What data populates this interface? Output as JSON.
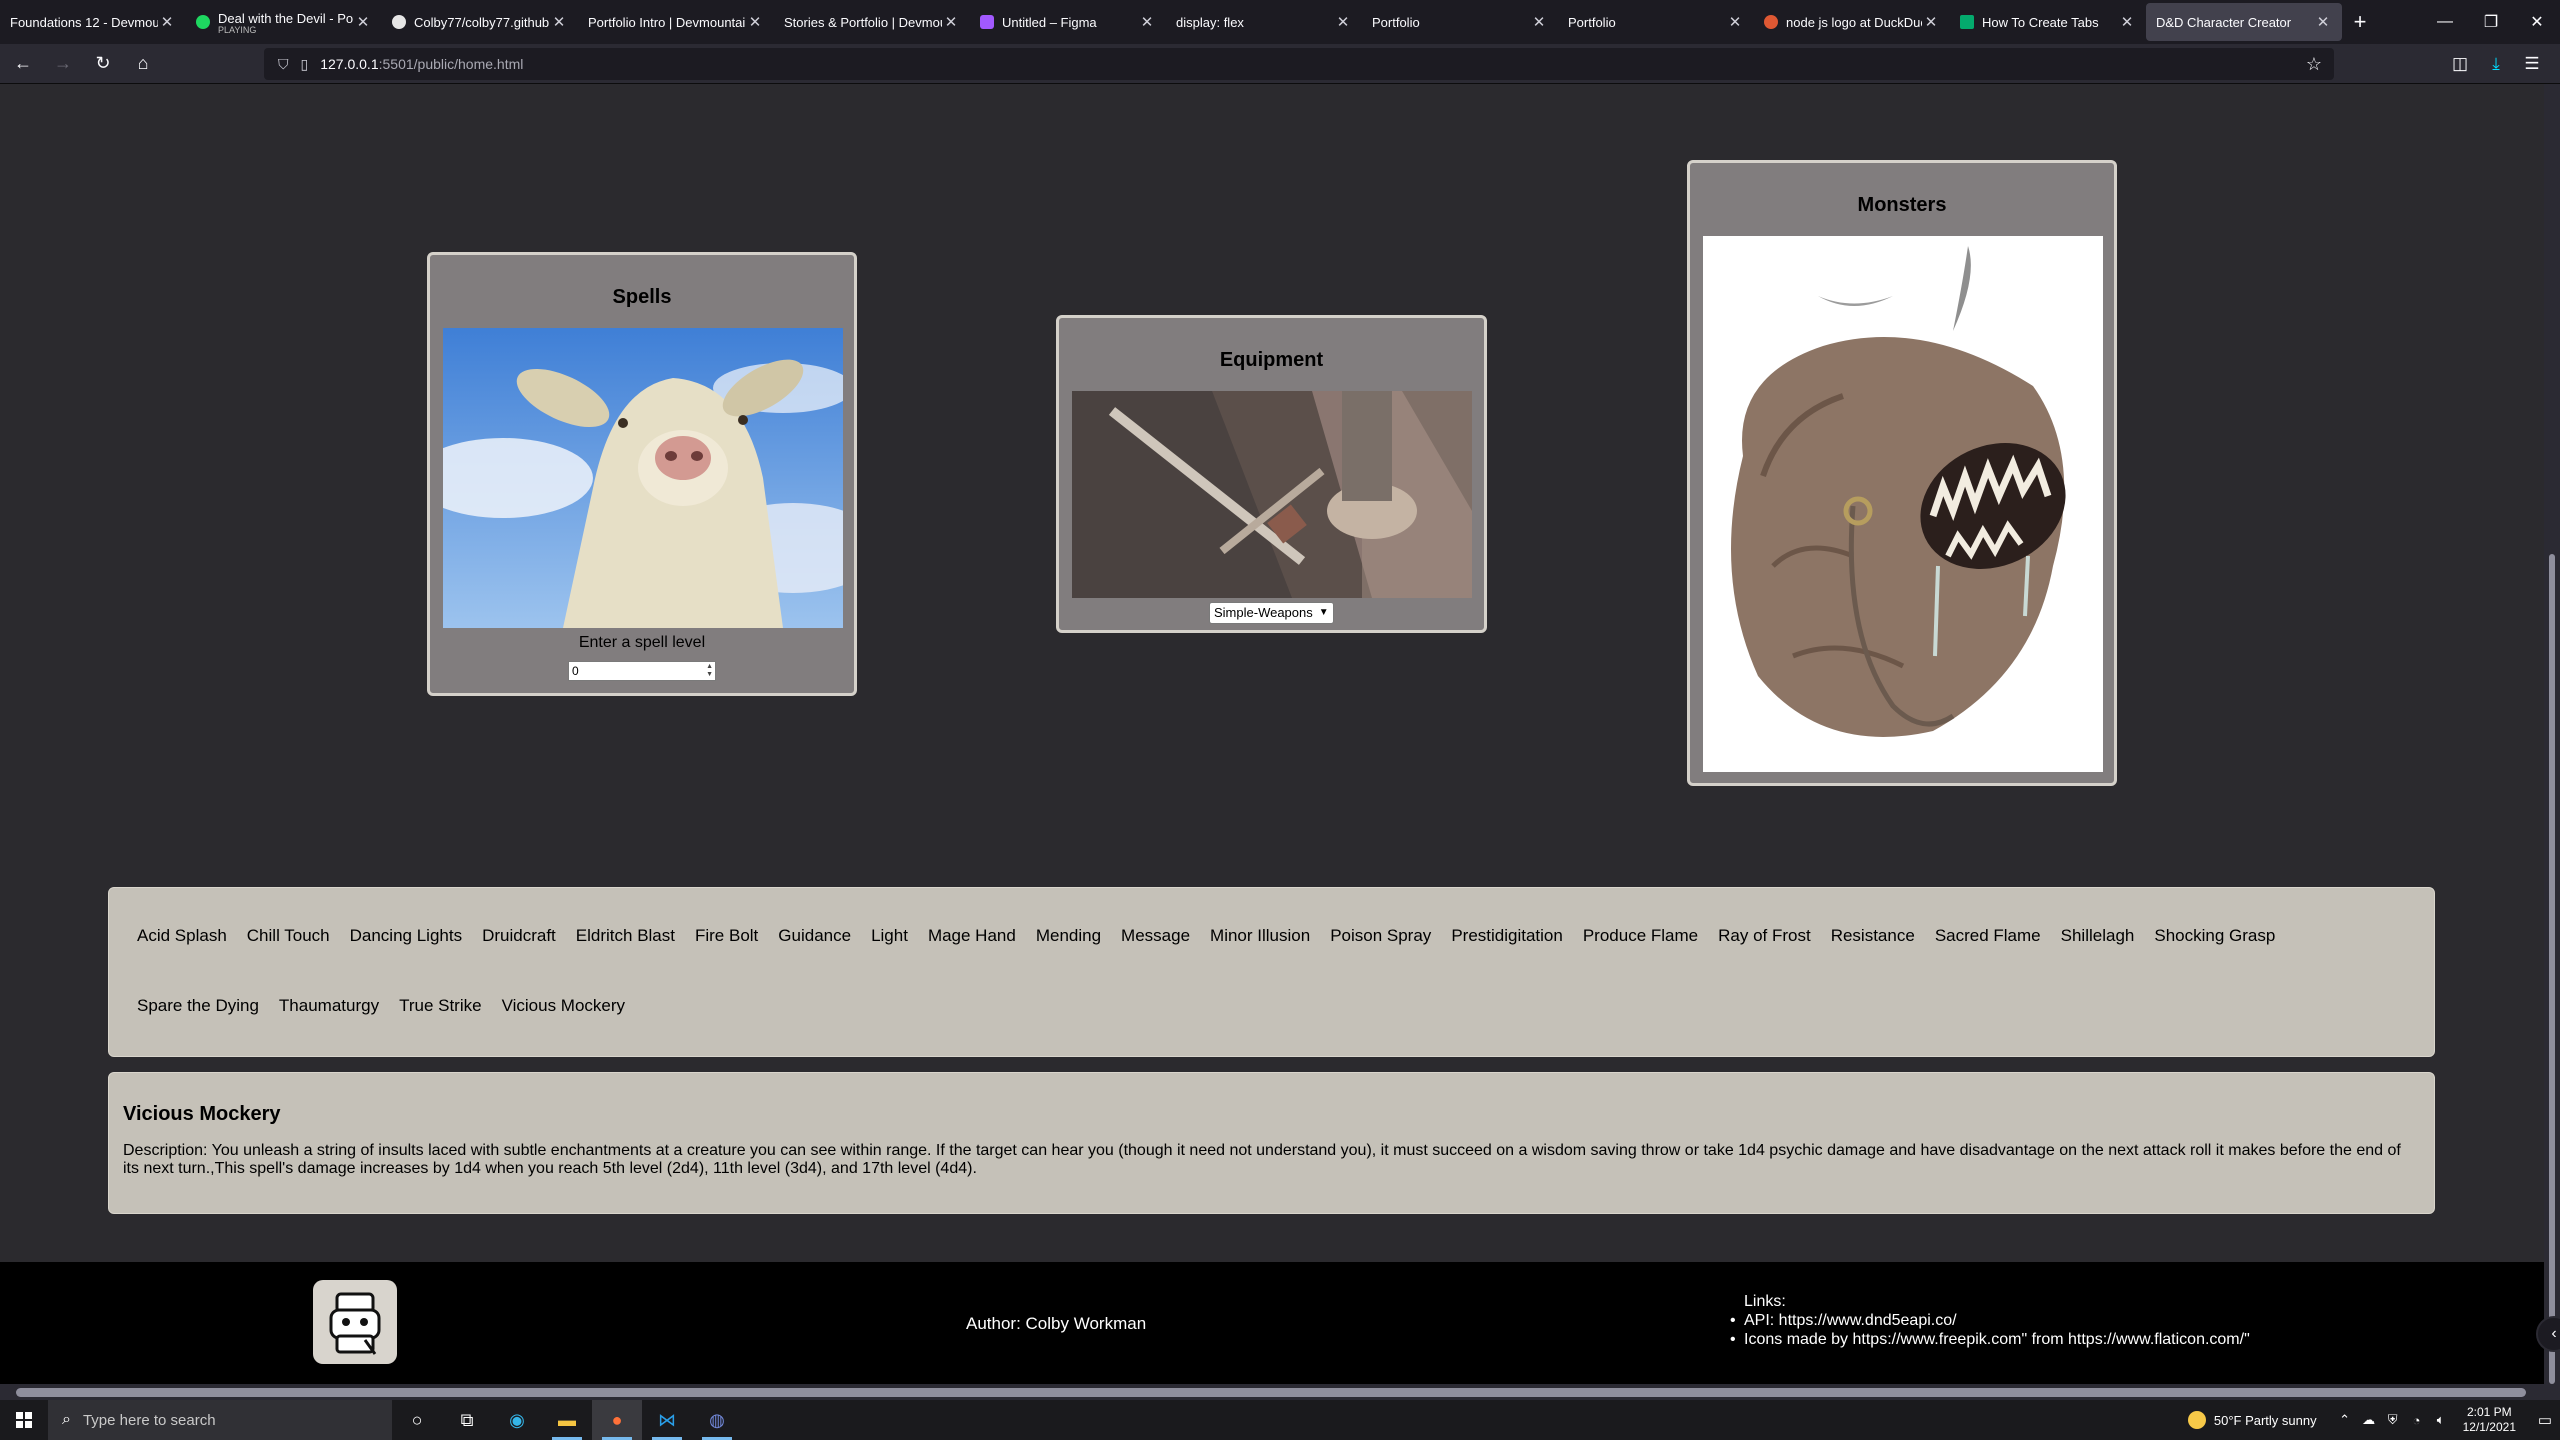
{
  "browser": {
    "tabs": [
      {
        "title": "Foundations 12 - Devmountain"
      },
      {
        "title": "Deal with the Devil - Pop Evil",
        "subtitle": "PLAYING"
      },
      {
        "title": "Colby77/colby77.github.io"
      },
      {
        "title": "Portfolio Intro | Devmountain"
      },
      {
        "title": "Stories & Portfolio | Devmountain"
      },
      {
        "title": "Untitled – Figma"
      },
      {
        "title": "display: flex"
      },
      {
        "title": "Portfolio"
      },
      {
        "title": "Portfolio"
      },
      {
        "title": "node js logo at DuckDuckGo"
      },
      {
        "title": "How To Create Tabs"
      },
      {
        "title": "D&D Character Creator"
      }
    ],
    "url_host": "127.0.0.1",
    "url_path": ":5501/public/home.html"
  },
  "cards": {
    "spells": {
      "title": "Spells",
      "level_label": "Enter a spell level",
      "level_value": "0"
    },
    "equipment": {
      "title": "Equipment",
      "select_value": "Simple-Weapons"
    },
    "monsters": {
      "title": "Monsters"
    }
  },
  "spell_list": [
    "Acid Splash",
    "Chill Touch",
    "Dancing Lights",
    "Druidcraft",
    "Eldritch Blast",
    "Fire Bolt",
    "Guidance",
    "Light",
    "Mage Hand",
    "Mending",
    "Message",
    "Minor Illusion",
    "Poison Spray",
    "Prestidigitation",
    "Produce Flame",
    "Ray of Frost",
    "Resistance",
    "Sacred Flame",
    "Shillelagh",
    "Shocking Grasp",
    "Spare the Dying",
    "Thaumaturgy",
    "True Strike",
    "Vicious Mockery"
  ],
  "spell_detail": {
    "name": "Vicious Mockery",
    "description": "Description: You unleash a string of insults laced with subtle enchantments at a creature you can see within range. If the target can hear you (though it need not understand you), it must succeed on a wisdom saving throw or take 1d4 psychic damage and have disadvantage on the next attack roll it makes before the end of its next turn.,This spell's damage increases by 1d4 when you reach 5th level (2d4), 11th level (3d4), and 17th level (4d4)."
  },
  "footer": {
    "author": "Author: Colby Workman",
    "links_heading": "Links:",
    "links": [
      "API: https://www.dnd5eapi.co/",
      "Icons made by https://www.freepik.com\" from https://www.flaticon.com/\""
    ]
  },
  "taskbar": {
    "search_placeholder": "Type here to search",
    "weather": "50°F  Partly sunny",
    "time": "2:01 PM",
    "date": "12/1/2021"
  },
  "colors": {
    "page_bg": "#2b2a2e",
    "card_bg": "#817d7e",
    "panel_bg": "#c5c1b8",
    "footer_bg": "#000000"
  }
}
